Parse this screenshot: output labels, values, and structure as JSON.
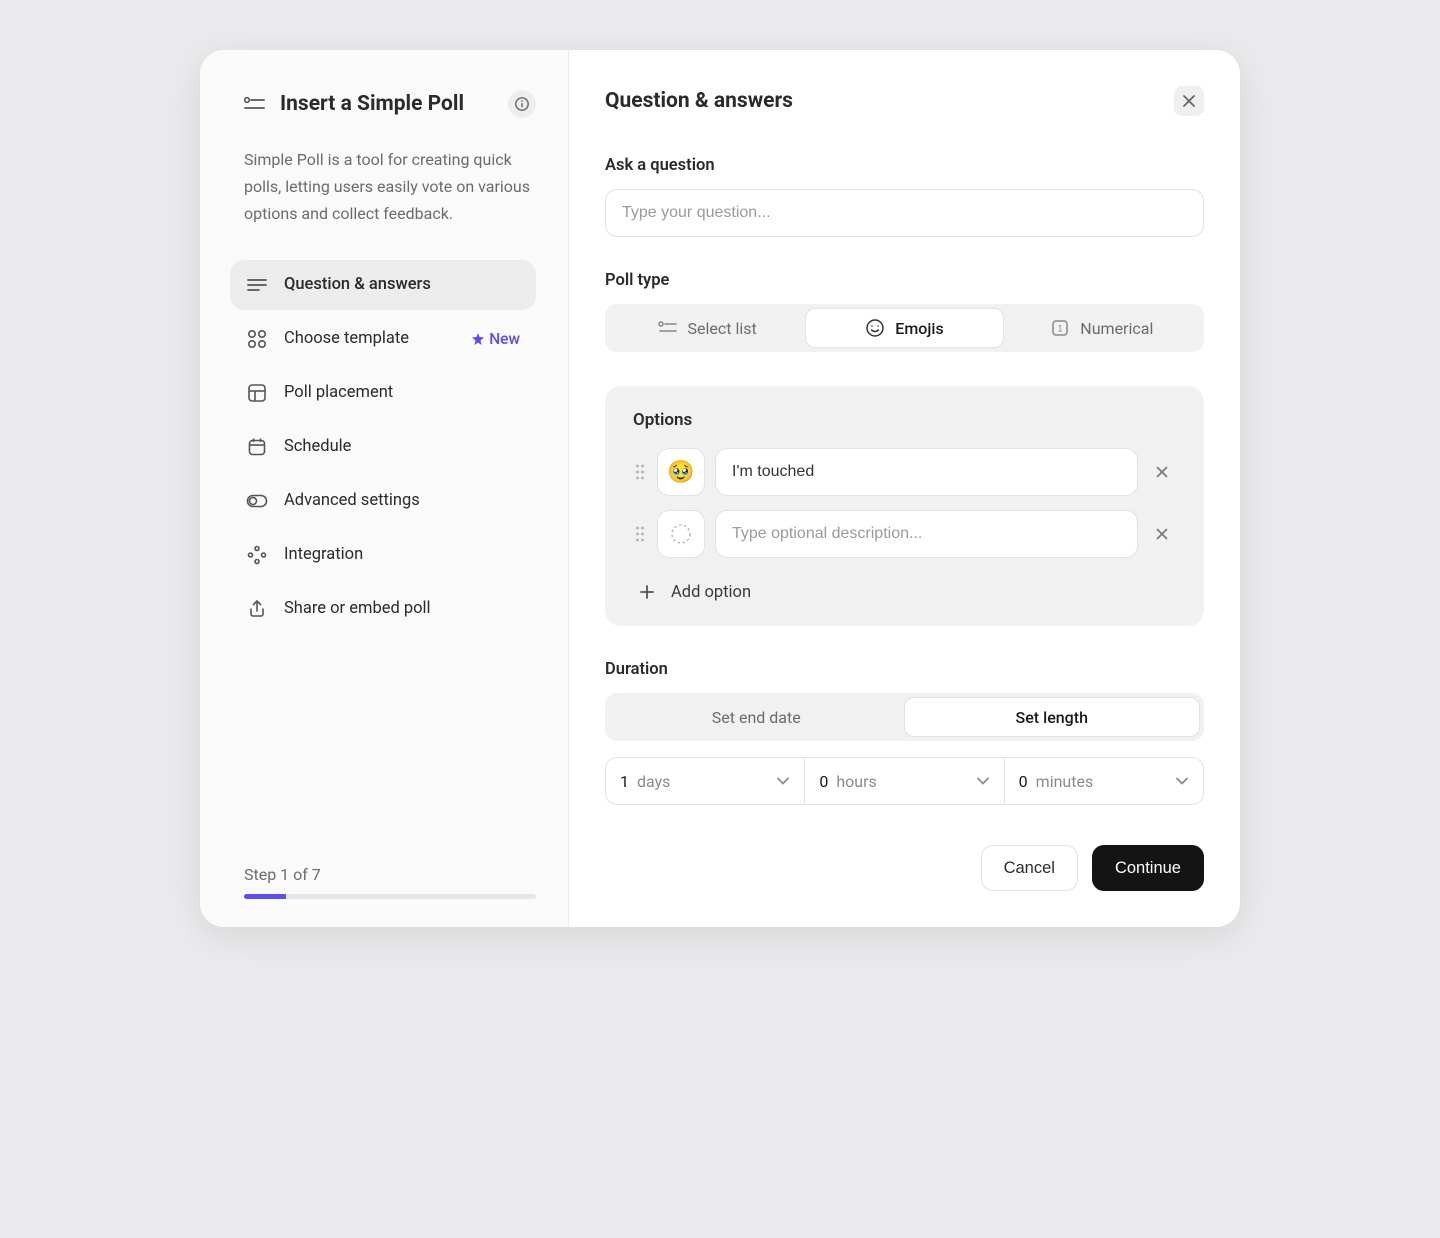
{
  "sidebar": {
    "title": "Insert a Simple Poll",
    "description": "Simple Poll is a tool for creating quick polls, letting users easily vote on various options and collect feedback.",
    "nav": [
      {
        "label": "Question & answers",
        "icon": "lines-icon",
        "active": true
      },
      {
        "label": "Choose template",
        "icon": "grid-icon",
        "badge": "New"
      },
      {
        "label": "Poll placement",
        "icon": "layout-icon"
      },
      {
        "label": "Schedule",
        "icon": "calendar-icon"
      },
      {
        "label": "Advanced settings",
        "icon": "toggle-icon"
      },
      {
        "label": "Integration",
        "icon": "nodes-icon"
      },
      {
        "label": "Share or embed poll",
        "icon": "share-icon"
      }
    ],
    "step_text": "Step 1 of 7",
    "progress_percent": 14.28
  },
  "main": {
    "title": "Question & answers",
    "ask_label": "Ask a question",
    "ask_placeholder": "Type your question...",
    "poll_type_label": "Poll type",
    "poll_types": [
      {
        "label": "Select list",
        "icon": "list-icon"
      },
      {
        "label": "Emojis",
        "icon": "smile-icon",
        "active": true
      },
      {
        "label": "Numerical",
        "icon": "number-icon"
      }
    ],
    "options": {
      "title": "Options",
      "rows": [
        {
          "emoji": "🥹",
          "value": "I'm touched",
          "placeholder": "Type optional description..."
        },
        {
          "emoji": "",
          "value": "",
          "placeholder": "Type optional description..."
        }
      ],
      "add_label": "Add option"
    },
    "duration": {
      "label": "Duration",
      "tabs": [
        {
          "label": "Set end date"
        },
        {
          "label": "Set length",
          "active": true
        }
      ],
      "cells": [
        {
          "value": "1",
          "unit": "days"
        },
        {
          "value": "0",
          "unit": "hours"
        },
        {
          "value": "0",
          "unit": "minutes"
        }
      ]
    },
    "footer": {
      "cancel": "Cancel",
      "continue": "Continue"
    }
  }
}
